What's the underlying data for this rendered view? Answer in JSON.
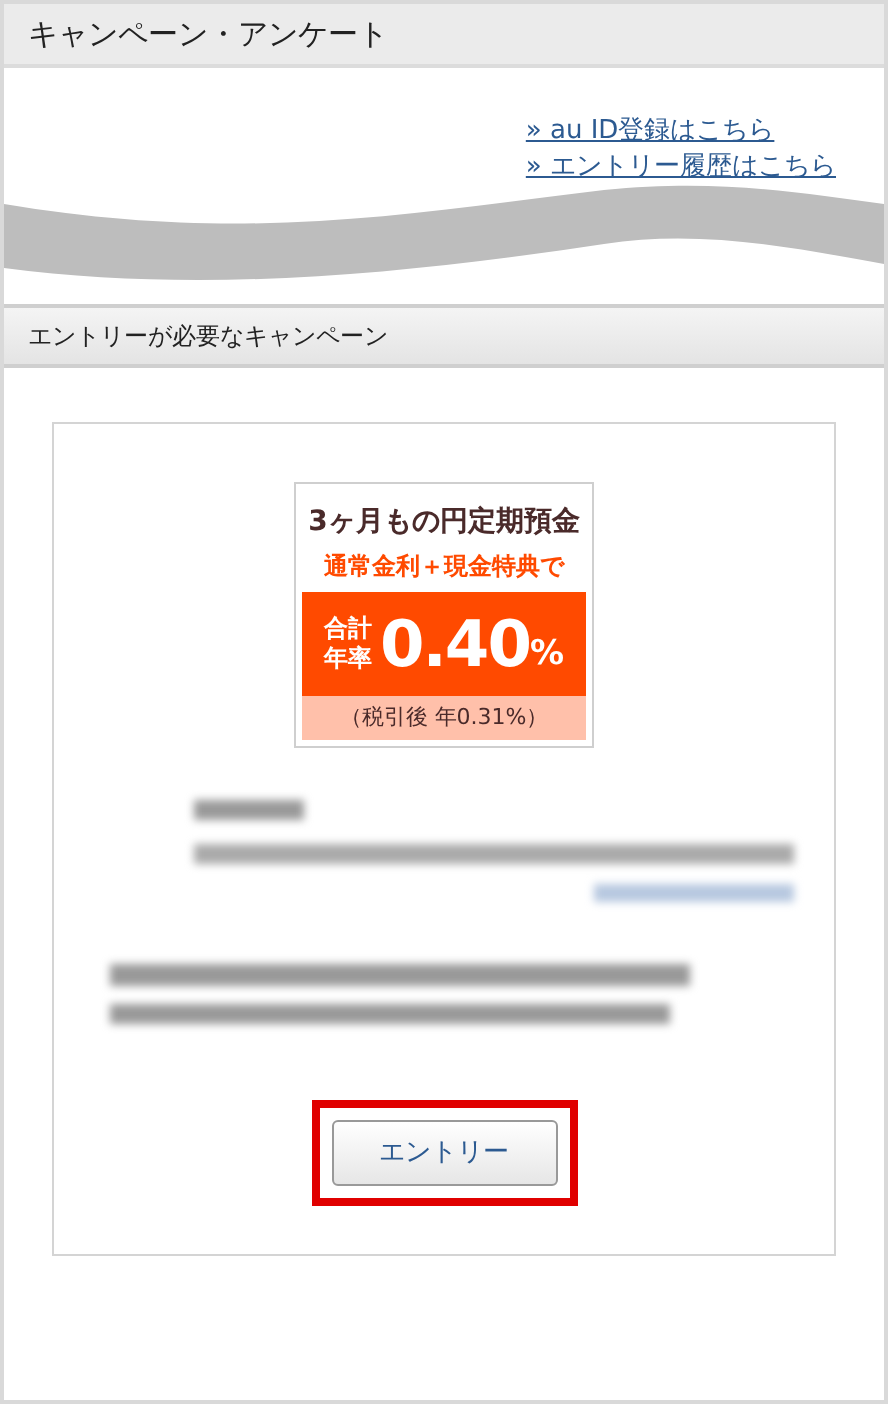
{
  "page_title": "キャンペーン・アンケート",
  "links": [
    "» au ID登録はこちら",
    "» エントリー履歴はこちら"
  ],
  "section_title": "エントリーが必要なキャンペーン",
  "campaign": {
    "banner": {
      "headline": "3ヶ月もの円定期預金",
      "subline": "通常金利＋現金特典で",
      "rate_label_1": "合計",
      "rate_label_2": "年率",
      "rate": "0.40",
      "unit": "%",
      "after_tax": "（税引後 年0.31%）"
    },
    "entry_button": {
      "label": "エントリー",
      "highlighted": true
    }
  }
}
